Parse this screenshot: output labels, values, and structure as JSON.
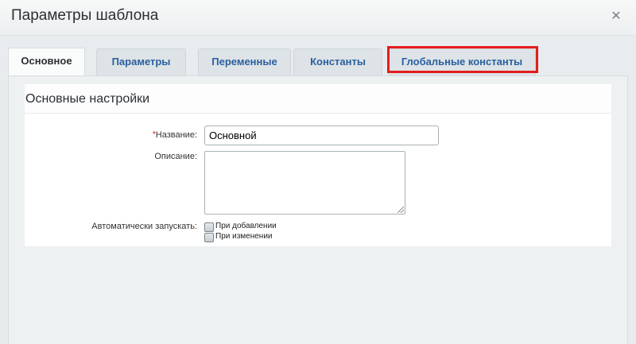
{
  "dialog": {
    "title": "Параметры шаблона"
  },
  "tabs": [
    {
      "label": "Основное",
      "active": true
    },
    {
      "label": "Параметры",
      "active": false
    },
    {
      "label": "Переменные",
      "active": false
    },
    {
      "label": "Константы",
      "active": false
    },
    {
      "label": "Глобальные константы",
      "active": false
    }
  ],
  "section": {
    "title": "Основные настройки"
  },
  "form": {
    "name_required_mark": "*",
    "name_label": "Название:",
    "name_value": "Основной",
    "description_label": "Описание:",
    "description_value": "",
    "autostart_label": "Автоматически запускать:",
    "options": [
      {
        "label": "При добавлении",
        "checked": false
      },
      {
        "label": "При изменении",
        "checked": false
      }
    ]
  },
  "colors": {
    "highlight": "#e41d1d",
    "tab_link": "#2a5fa0"
  },
  "icons": {
    "close": "close-icon"
  }
}
